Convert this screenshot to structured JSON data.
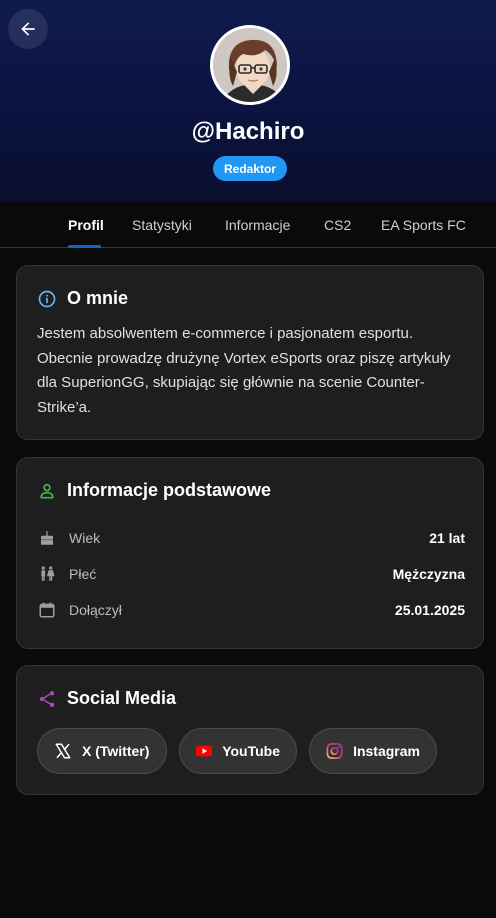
{
  "header": {
    "username": "@Hachiro",
    "role": "Redaktor"
  },
  "tabs": [
    {
      "label": "Profil"
    },
    {
      "label": "Statystyki"
    },
    {
      "label": "Informacje"
    },
    {
      "label": "CS2"
    },
    {
      "label": "EA Sports FC"
    }
  ],
  "about": {
    "title": "O mnie",
    "text": "Jestem absolwentem e-commerce i pasjonatem esportu. Obecnie prowadzę drużynę Vortex eSports oraz piszę artykuły dla SuperionGG, skupiając się głównie na scenie Counter-Strike’a."
  },
  "basic_info": {
    "title": "Informacje podstawowe",
    "rows": [
      {
        "label": "Wiek",
        "value": "21 lat",
        "icon": "cake-icon"
      },
      {
        "label": "Płeć",
        "value": "Mężczyzna",
        "icon": "people-icon"
      },
      {
        "label": "Dołączył",
        "value": "25.01.2025",
        "icon": "calendar-icon"
      }
    ]
  },
  "social": {
    "title": "Social Media",
    "links": [
      {
        "label": "X (Twitter)",
        "icon": "x-icon"
      },
      {
        "label": "YouTube",
        "icon": "youtube-icon"
      },
      {
        "label": "Instagram",
        "icon": "instagram-icon"
      }
    ]
  },
  "colors": {
    "accent": "#2196f3",
    "info_icon": "#64b5f6",
    "person_icon": "#4caf50",
    "share_icon": "#ab47bc",
    "youtube_red": "#ff0000",
    "tab_indicator": "#1565c0"
  }
}
